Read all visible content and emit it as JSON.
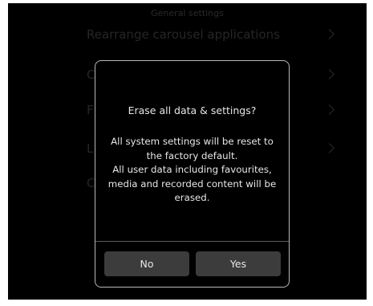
{
  "header": {
    "title": "General settings"
  },
  "background_list": {
    "items": [
      {
        "label": "Rearrange carousel applications"
      },
      {
        "label": "C"
      },
      {
        "label": "F"
      },
      {
        "label": "L"
      },
      {
        "label": "C"
      }
    ]
  },
  "dialog": {
    "title": "Erase all data & settings?",
    "body_lines": [
      "All system settings will be reset to",
      "the factory default.",
      "All user data including favourites,",
      "media and recorded content will be",
      "erased."
    ],
    "no_label": "No",
    "yes_label": "Yes"
  },
  "colors": {
    "screen_background": "#000000",
    "dialog_border": "#b8b8b8",
    "button_background": "#3c3c3c",
    "text": "#e6e6e6"
  }
}
